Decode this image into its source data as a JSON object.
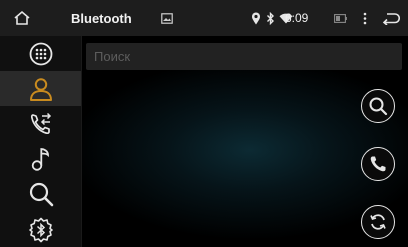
{
  "status_bar": {
    "title": "Bluetooth",
    "time": "6:09",
    "icons": [
      "home-icon",
      "image-icon",
      "location-icon",
      "bluetooth-icon",
      "wifi-icon",
      "battery-icon",
      "overflow-menu-icon",
      "back-icon"
    ]
  },
  "sidebar": {
    "items": [
      {
        "icon": "dialpad-icon",
        "active": false
      },
      {
        "icon": "contacts-icon",
        "active": true
      },
      {
        "icon": "call-history-icon",
        "active": false
      },
      {
        "icon": "music-icon",
        "active": false
      },
      {
        "icon": "search-icon",
        "active": false
      },
      {
        "icon": "bluetooth-settings-icon",
        "active": false
      }
    ]
  },
  "main": {
    "search_placeholder": "Поиск",
    "actions": [
      "search-icon",
      "call-icon",
      "sync-icon"
    ]
  },
  "colors": {
    "accent": "#c98b1f",
    "statusbar_bg": "#1d1d1d",
    "sidebar_bg": "#101010"
  }
}
